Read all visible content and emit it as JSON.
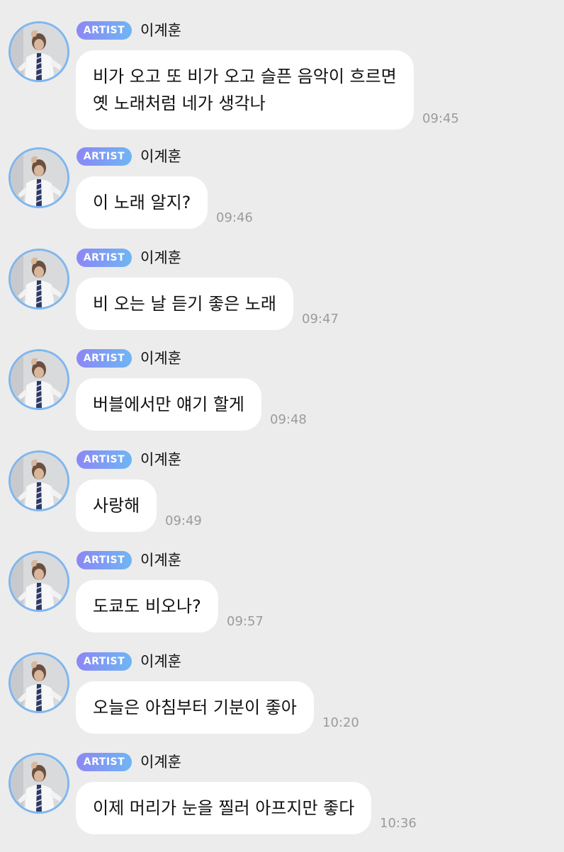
{
  "badge_label": "ARTIST",
  "sender_name": "이계훈",
  "colors": {
    "background": "#ececec",
    "bubble": "#ffffff",
    "badge_gradient_start": "#8c87f5",
    "badge_gradient_end": "#6fb5f4",
    "avatar_ring": "#7fb6ee",
    "timestamp": "#9b9b9b"
  },
  "messages": [
    {
      "text": "비가 오고 또 비가 오고 슬픈 음악이 흐르면\n옛 노래처럼 네가 생각나",
      "time": "09:45"
    },
    {
      "text": "이 노래 알지?",
      "time": "09:46"
    },
    {
      "text": "비 오는 날 듣기 좋은 노래",
      "time": "09:47"
    },
    {
      "text": "버블에서만 얘기 할게",
      "time": "09:48"
    },
    {
      "text": "사랑해",
      "time": "09:49"
    },
    {
      "text": "도쿄도 비오나?",
      "time": "09:57"
    },
    {
      "text": "오늘은 아침부터 기분이 좋아",
      "time": "10:20"
    },
    {
      "text": "이제 머리가 눈을 찔러 아프지만 좋다",
      "time": "10:36"
    }
  ]
}
